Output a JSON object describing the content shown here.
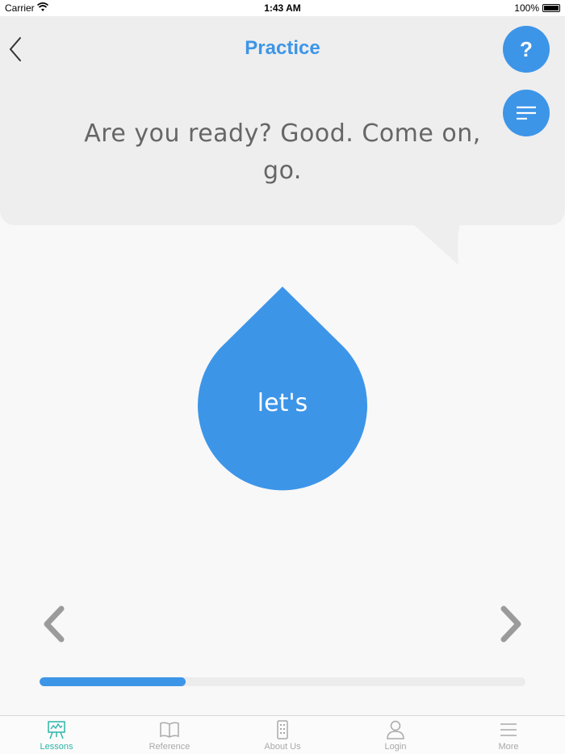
{
  "status_bar": {
    "carrier": "Carrier",
    "time": "1:43 AM",
    "battery": "100%"
  },
  "nav": {
    "title": "Practice",
    "help_label": "?"
  },
  "prompt": {
    "text": "Are you ready? Good. Come on, go."
  },
  "word_drop": {
    "label": "let's"
  },
  "progress": {
    "fraction": 0.3
  },
  "tabs": [
    {
      "label": "Lessons",
      "icon": "easel-chart-icon",
      "active": true
    },
    {
      "label": "Reference",
      "icon": "book-icon",
      "active": false
    },
    {
      "label": "About Us",
      "icon": "building-icon",
      "active": false
    },
    {
      "label": "Login",
      "icon": "person-icon",
      "active": false
    },
    {
      "label": "More",
      "icon": "menu-lines-icon",
      "active": false
    }
  ],
  "colors": {
    "accent": "#3d95e8",
    "active_tab": "#2eb5a8",
    "bubble": "#eeeeee",
    "text": "#666666"
  }
}
